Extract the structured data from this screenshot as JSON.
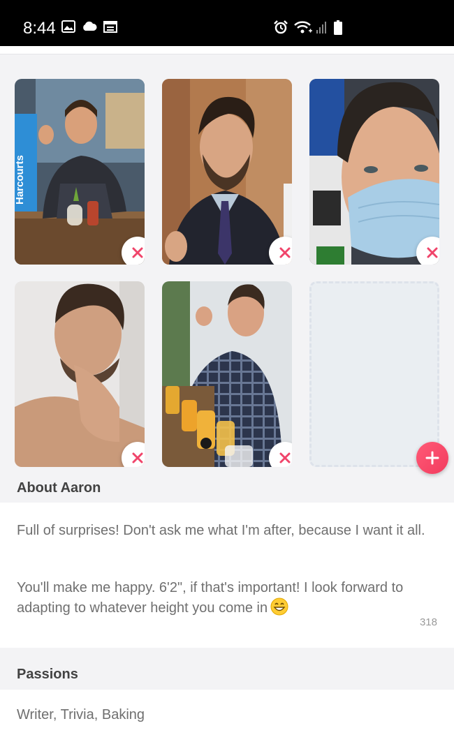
{
  "status_bar": {
    "time": "8:44",
    "icons_left": [
      "image-icon",
      "cloud-icon",
      "calendar-icon"
    ],
    "icons_right": [
      "alarm-icon",
      "wifi-icon",
      "signal-icon",
      "battery-icon"
    ]
  },
  "photos": [
    {
      "description_icon": "photo",
      "remove_icon": "close-icon",
      "sign_text": "Harcourts"
    },
    {
      "description_icon": "photo",
      "remove_icon": "close-icon"
    },
    {
      "description_icon": "photo",
      "remove_icon": "close-icon"
    },
    {
      "description_icon": "photo",
      "remove_icon": "close-icon"
    },
    {
      "description_icon": "photo",
      "remove_icon": "close-icon"
    }
  ],
  "add_photo": {
    "icon": "plus-icon"
  },
  "about": {
    "header": "About Aaron",
    "paragraph_1": "Full of surprises! Don't ask me what I'm after, because I want it all.",
    "paragraph_2": "You'll make me happy. 6'2\", if that's important! I look forward to adapting to whatever height you come in",
    "emoji": "grinning-face-icon",
    "char_count": "318"
  },
  "passions": {
    "header": "Passions",
    "value": "Writer, Trivia, Baking"
  },
  "colors": {
    "accent": "#f23c5e",
    "remove_x": "#f0446a"
  }
}
